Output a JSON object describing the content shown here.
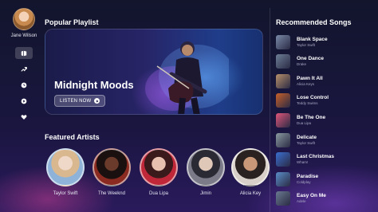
{
  "user": {
    "name": "Jane Wilson"
  },
  "sidebar": {
    "items": [
      {
        "icon": "library-icon",
        "active": true
      },
      {
        "icon": "trending-icon",
        "active": false
      },
      {
        "icon": "clock-icon",
        "active": false
      },
      {
        "icon": "play-circle-icon",
        "active": false
      },
      {
        "icon": "heart-icon",
        "active": false
      }
    ]
  },
  "playlist": {
    "heading": "Popular Playlist",
    "title": "Midnight Moods",
    "button_label": "LISTEN NOW"
  },
  "artists": {
    "heading": "Featured Artists",
    "items": [
      {
        "name": "Taylor Swift"
      },
      {
        "name": "The Weeknd"
      },
      {
        "name": "Dua Lipa"
      },
      {
        "name": "Jimin"
      },
      {
        "name": "Alicia Key"
      }
    ]
  },
  "recommended": {
    "heading": "Recommended Songs",
    "songs": [
      {
        "title": "Blank Space",
        "artist": "Taylor Swift",
        "color": "#7a8aa8"
      },
      {
        "title": "One Dance",
        "artist": "Drake",
        "color": "#6d7f96"
      },
      {
        "title": "Pawn It All",
        "artist": "Alicia Keys",
        "color": "#b8906a"
      },
      {
        "title": "Lose Control",
        "artist": "Teddy Swims",
        "color": "#c8602a"
      },
      {
        "title": "Be The One",
        "artist": "Dua Lipa",
        "color": "#e0567a"
      },
      {
        "title": "Delicate",
        "artist": "Taylor Swift",
        "color": "#8a9aa0"
      },
      {
        "title": "Last Christmas",
        "artist": "Wham!",
        "color": "#3b6fd0"
      },
      {
        "title": "Paradise",
        "artist": "Coldplay",
        "color": "#5a8ec8"
      },
      {
        "title": "Easy On Me",
        "artist": "Adele",
        "color": "#6a7a90"
      }
    ]
  }
}
